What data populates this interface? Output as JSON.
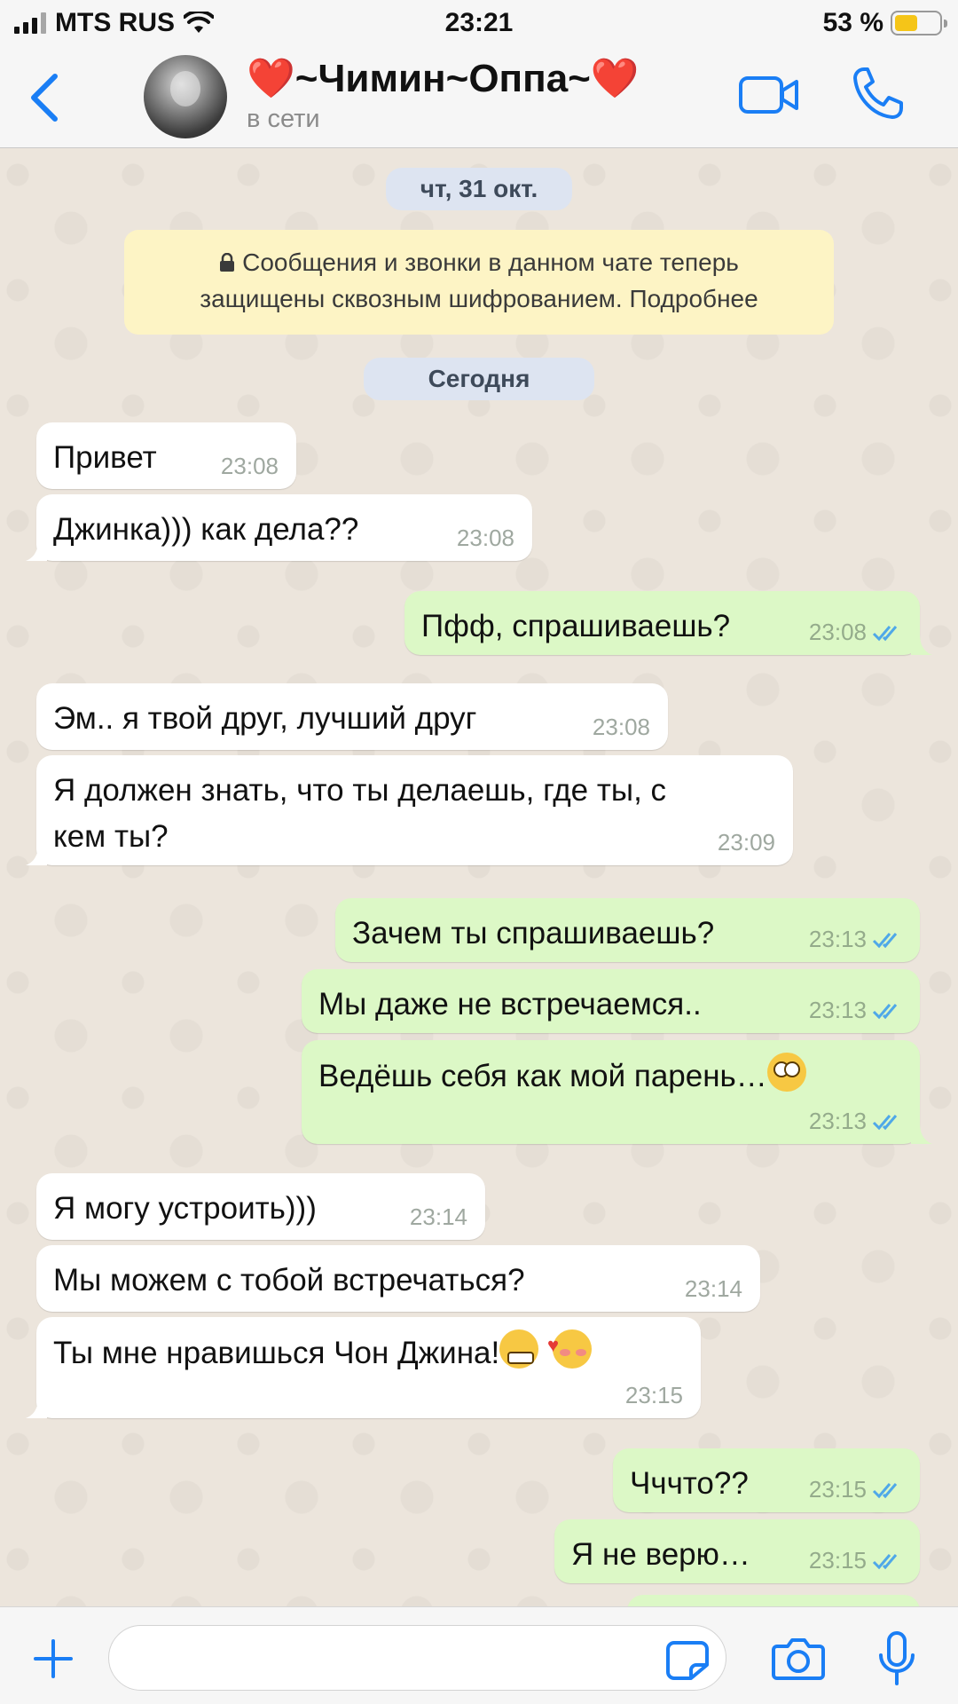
{
  "status_bar": {
    "carrier": "MTS RUS",
    "time": "23:21",
    "battery": "53 %",
    "battery_level": 0.53
  },
  "header": {
    "contact_name": "❤️~Чимин~Оппа~❤️",
    "status": "в сети",
    "icons": {
      "back": "chevron-left-icon",
      "video": "video-camera-icon",
      "call": "phone-icon"
    }
  },
  "chat": {
    "date_label": "чт, 31 окт.",
    "encryption_notice": {
      "line1": "Сообщения и звонки в данном чате теперь",
      "line2": "защищены сквозным шифрованием. Подробнее"
    },
    "today_label": "Сегодня",
    "messages": [
      {
        "dir": "in",
        "text": "Привет",
        "time": "23:08"
      },
      {
        "dir": "in",
        "text": "Джинка))) как дела??",
        "time": "23:08"
      },
      {
        "dir": "out",
        "text": "Пфф, спрашиваешь?",
        "time": "23:08"
      },
      {
        "dir": "in",
        "text": "Эм.. я твой друг, лучший друг",
        "time": "23:08"
      },
      {
        "dir": "in",
        "line1": "Я должен знать, что ты делаешь, где ты, с",
        "line2": "кем ты?",
        "time": "23:09"
      },
      {
        "dir": "out",
        "text": "Зачем ты спрашиваешь?",
        "time": "23:13"
      },
      {
        "dir": "out",
        "text": "Мы даже не встречаемся..",
        "time": "23:13"
      },
      {
        "dir": "out",
        "text": "Ведёшь себя как мой парень…",
        "emoji": "🙄",
        "time": "23:13"
      },
      {
        "dir": "in",
        "text": "Я могу устроить)))",
        "time": "23:14"
      },
      {
        "dir": "in",
        "text": "Мы можем с тобой встречаться?",
        "time": "23:14"
      },
      {
        "dir": "in",
        "text": "Ты мне нравишься Чон Джина!",
        "emoji": "😬 🥰",
        "time": "23:15"
      },
      {
        "dir": "out",
        "text": "Чччто??",
        "time": "23:15"
      },
      {
        "dir": "out",
        "text": "Я не верю…",
        "time": "23:15"
      }
    ]
  },
  "input_bar": {
    "icons": {
      "attach": "plus-icon",
      "sticker": "sticker-icon",
      "camera": "camera-icon",
      "mic": "microphone-icon"
    }
  },
  "colors": {
    "accent": "#1a7ef5",
    "outgoing_bubble": "#dcf8c6",
    "incoming_bubble": "#ffffff",
    "encryption_bg": "#fdf4c5",
    "date_pill_bg": "#dde4f1",
    "read_ticks": "#4fa8e8"
  }
}
